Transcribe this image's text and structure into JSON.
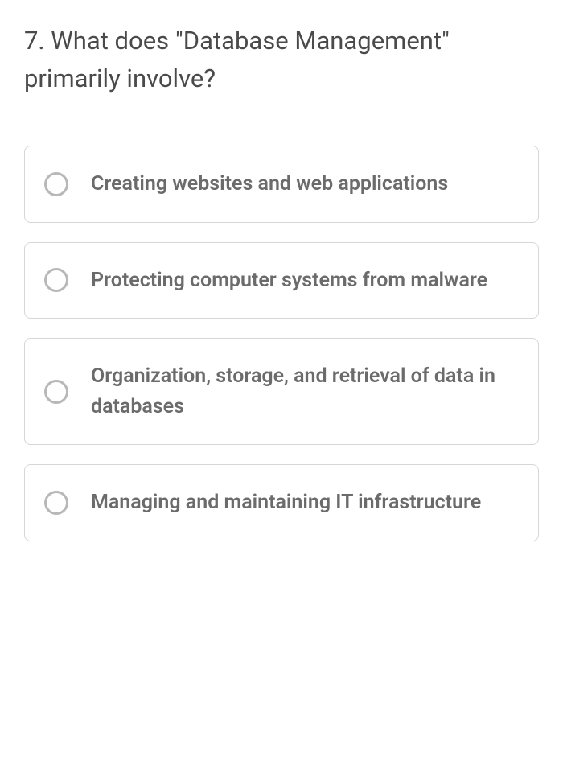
{
  "question": {
    "number": "7.",
    "text": "7. What does \"Database Management\" primarily involve?"
  },
  "options": [
    {
      "label": "Creating websites and web applications"
    },
    {
      "label": "Protecting computer systems from malware"
    },
    {
      "label": "Organization, storage, and retrieval of data in databases"
    },
    {
      "label": "Managing and maintaining IT infrastructure"
    }
  ]
}
